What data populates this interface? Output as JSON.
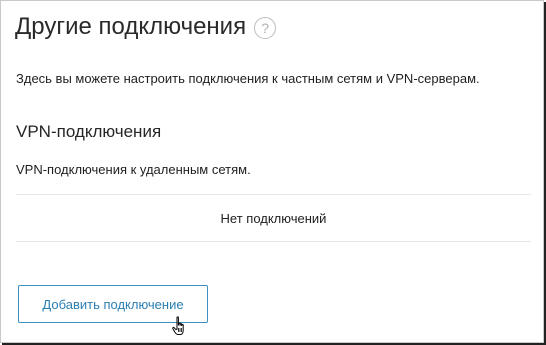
{
  "header": {
    "title": "Другие подключения",
    "help_icon_glyph": "?"
  },
  "description": "Здесь вы можете настроить подключения к частным сетям и VPN-серверам.",
  "vpn_section": {
    "title": "VPN-подключения",
    "description": "VPN-подключения к удаленным сетям.",
    "empty_message": "Нет подключений",
    "add_button_label": "Добавить подключение"
  },
  "icons": {
    "help": "question-circle-icon",
    "cursor": "hand-pointer-cursor-icon"
  },
  "colors": {
    "accent": "#2b7fb3",
    "button_border": "#3d8fbd",
    "help_icon": "#b0b0b0",
    "divider": "#e8e8e8"
  }
}
